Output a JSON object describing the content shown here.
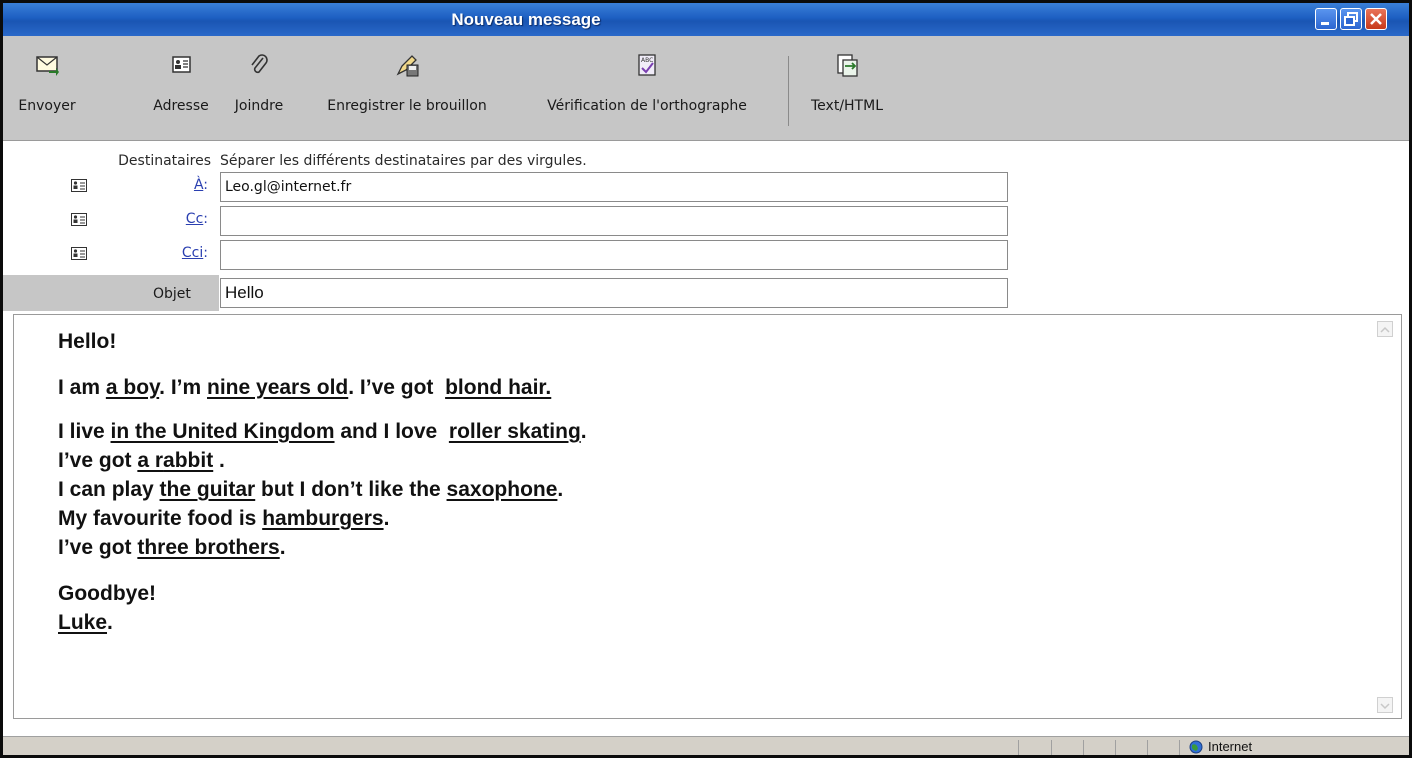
{
  "window": {
    "title": "Nouveau message",
    "title_color": "#1d5fc2"
  },
  "toolbar": {
    "send_label": "Envoyer",
    "address_label": "Adresse",
    "attach_label": "Joindre",
    "save_draft_label": "Enregistrer le brouillon",
    "spellcheck_label": "Vérification de l'orthographe",
    "format_label": "Text/HTML"
  },
  "headers": {
    "recipients_label": "Destinataires",
    "recipients_hint": "Séparer les différents destinataires par des virgules.",
    "to_label": "À",
    "to_value": "Leo.gl@internet.fr",
    "cc_label": "Cc",
    "cc_value": "",
    "bcc_label": "Cci",
    "bcc_value": "",
    "subject_label": "Objet",
    "subject_value": "Hello"
  },
  "body": {
    "greeting": "Hello!",
    "line1": [
      "I am ",
      "a boy",
      ". I’m ",
      "nine years old",
      ". I’ve got  ",
      "blond hair."
    ],
    "line2": [
      "I live ",
      "in the United Kingdom",
      " and I love  ",
      "roller skating",
      "."
    ],
    "line3": [
      "I’ve got ",
      "a r",
      "abbit",
      " ."
    ],
    "line4": [
      "I can play ",
      "the guitar",
      " but I don’t like the ",
      "saxophone",
      "."
    ],
    "line5": [
      "My favourite food is ",
      "hamburgers",
      "."
    ],
    "line6": [
      "I’ve got ",
      "three brothers",
      "."
    ],
    "closing": "Goodbye!",
    "signature": [
      "Luke",
      "."
    ]
  },
  "status": {
    "zone": "Internet"
  }
}
